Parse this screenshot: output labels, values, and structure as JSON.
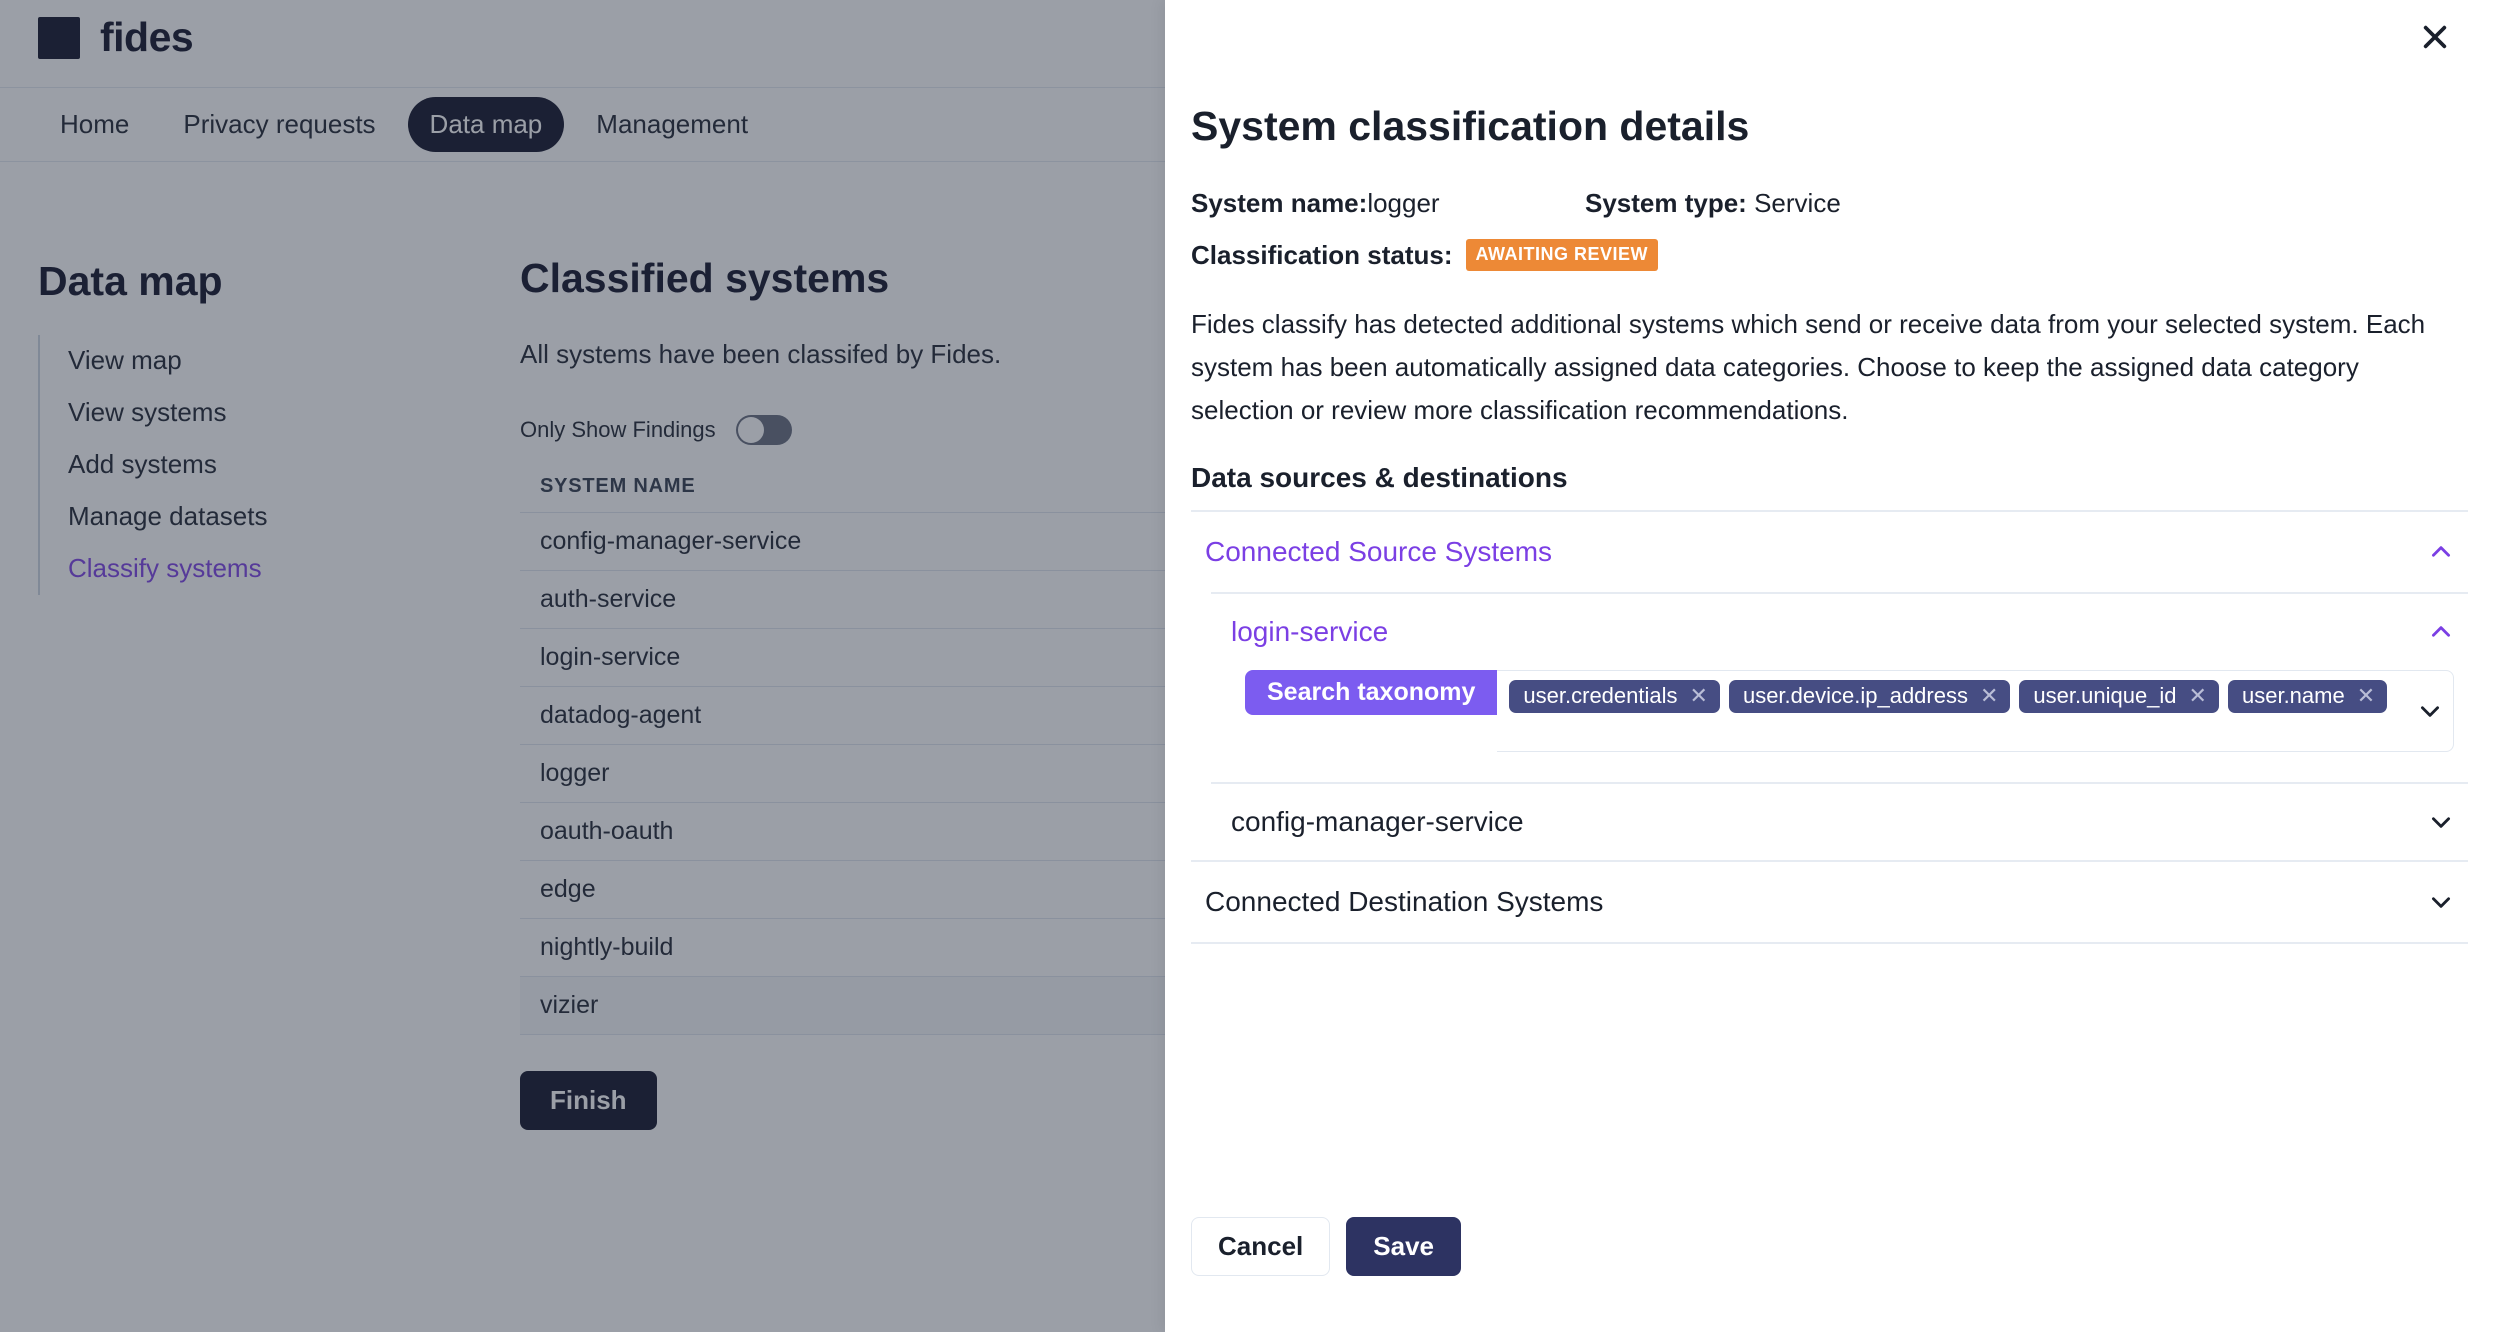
{
  "colors": {
    "brand_dark": "#0b0d23",
    "accent_purple": "#7B3FE4",
    "taxonomy_purple": "#7C5CF0",
    "tag_indigo": "#464D83",
    "badge_orange": "#ED8936",
    "save_navy": "#2D3362",
    "divider": "#e6ebf2"
  },
  "app": {
    "brand": {
      "name": "fides",
      "logo_icon": "square-logo-icon"
    },
    "nav": [
      {
        "label": "Home",
        "active": false
      },
      {
        "label": "Privacy requests",
        "active": false
      },
      {
        "label": "Data map",
        "active": true
      },
      {
        "label": "Management",
        "active": false
      }
    ],
    "sidebar": {
      "title": "Data map",
      "items": [
        {
          "label": "View map",
          "active": false
        },
        {
          "label": "View systems",
          "active": false
        },
        {
          "label": "Add systems",
          "active": false
        },
        {
          "label": "Manage datasets",
          "active": false
        },
        {
          "label": "Classify systems",
          "active": true
        }
      ]
    },
    "main": {
      "title": "Classified systems",
      "subtitle": "All systems have been classifed by Fides.",
      "toggle": {
        "label": "Only Show Findings",
        "state": "off"
      },
      "table": {
        "columns": [
          "SYSTEM NAME"
        ],
        "rows": [
          {
            "name": "config-manager-service",
            "hovered": false
          },
          {
            "name": "auth-service",
            "hovered": false
          },
          {
            "name": "login-service",
            "hovered": false
          },
          {
            "name": "datadog-agent",
            "hovered": false
          },
          {
            "name": "logger",
            "hovered": false
          },
          {
            "name": "oauth-oauth",
            "hovered": false
          },
          {
            "name": "edge",
            "hovered": false
          },
          {
            "name": "nightly-build",
            "hovered": false
          },
          {
            "name": "vizier",
            "hovered": true
          }
        ]
      },
      "finish_label": "Finish"
    }
  },
  "modal": {
    "close_icon": "close-icon",
    "title": "System classification details",
    "system_name_label": "System name:",
    "system_name_value": "logger",
    "system_type_label": "System type:",
    "system_type_value": "Service",
    "status_label": "Classification status:",
    "status_badge": "AWAITING REVIEW",
    "description": "Fides classify has detected additional systems which send or receive data from your selected system. Each system has been automatically assigned data categories. Choose to keep the assigned data category selection or review more classification recommendations.",
    "section_title": "Data sources & destinations",
    "accordions": [
      {
        "label": "Connected Source Systems",
        "expanded": true,
        "chevron": "chevron-up-icon",
        "purple": true,
        "children": [
          {
            "label": "login-service",
            "expanded": true,
            "chevron": "chevron-up-icon",
            "purple": true,
            "taxonomy": {
              "button_label": "Search taxonomy",
              "chevron": "chevron-down-icon",
              "tags": [
                "user.credentials",
                "user.device.ip_address",
                "user.unique_id",
                "user.name"
              ],
              "tag_remove_icon": "close-icon"
            }
          },
          {
            "label": "config-manager-service",
            "expanded": false,
            "chevron": "chevron-down-icon",
            "purple": false
          }
        ]
      },
      {
        "label": "Connected Destination Systems",
        "expanded": false,
        "chevron": "chevron-down-icon",
        "purple": false,
        "children": []
      }
    ],
    "cancel_label": "Cancel",
    "save_label": "Save"
  }
}
